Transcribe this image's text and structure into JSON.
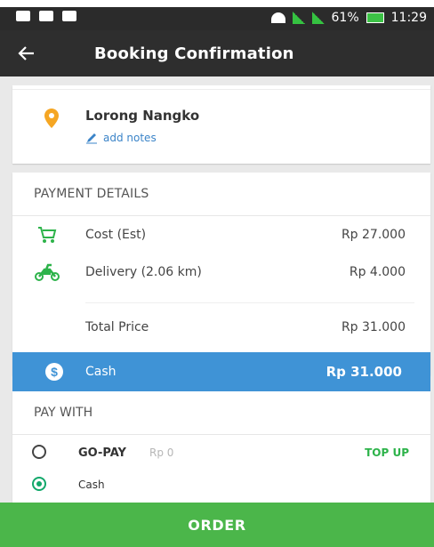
{
  "status": {
    "battery": "61%",
    "time": "11:29"
  },
  "appbar": {
    "title": "Booking Confirmation"
  },
  "location": {
    "name": "Lorong Nangko",
    "notes_label": "add notes"
  },
  "payment": {
    "title": "PAYMENT DETAILS",
    "cost": {
      "label": "Cost (Est)",
      "amount": "Rp 27.000"
    },
    "delivery": {
      "label": "Delivery (2.06 km)",
      "amount": "Rp 4.000"
    },
    "total": {
      "label": "Total Price",
      "amount": "Rp 31.000"
    },
    "cash": {
      "label": "Cash",
      "amount": "Rp 31.000"
    }
  },
  "paywith": {
    "title": "PAY WITH",
    "options": [
      {
        "label": "GO-PAY",
        "sub": "Rp 0",
        "action": "TOP UP",
        "selected": false
      },
      {
        "label": "Cash",
        "selected": true
      }
    ]
  },
  "footer": {
    "order_label": "ORDER"
  },
  "colors": {
    "appbar": "#2e2e2e",
    "accent_blue": "#3f93d6",
    "order_green": "#4bb64a",
    "pin_orange": "#f5a623"
  }
}
